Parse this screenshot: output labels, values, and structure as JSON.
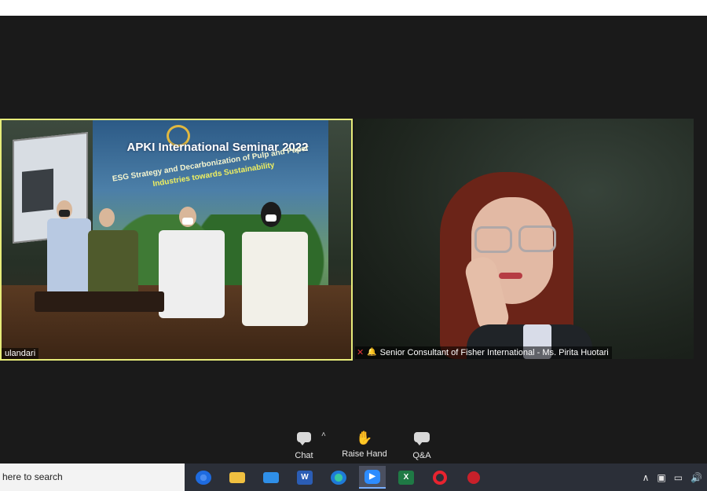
{
  "left_tile": {
    "banner_title": "APKI International Seminar 2022",
    "banner_subtitle_1": "ESG Strategy and Decarbonization of Pulp and Paper",
    "banner_subtitle_2": "Industries towards Sustainability",
    "participant_name": "ulandari"
  },
  "right_tile": {
    "participant_name": "Senior Consultant of Fisher International - Ms. Pirita Huotari"
  },
  "controls": {
    "chat_label": "Chat",
    "raise_hand_label": "Raise Hand",
    "qa_label": "Q&A"
  },
  "taskbar": {
    "search_text": "here to search",
    "apps": [
      "chrome-icon",
      "file-explorer-icon",
      "mail-icon",
      "word-icon",
      "edge-icon",
      "zoom-icon",
      "excel-icon",
      "opera-icon",
      "app-icon"
    ],
    "active_app": "zoom-icon"
  },
  "colors": {
    "active_speaker_border": "#e7ec7a",
    "meeting_background": "#1a1a1a",
    "taskbar": "#2b2f38"
  }
}
